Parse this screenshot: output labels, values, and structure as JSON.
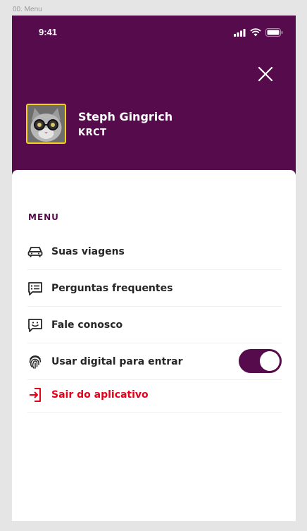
{
  "frame_label": "00. Menu",
  "status_bar": {
    "time": "9:41"
  },
  "profile": {
    "name": "Steph Gingrich",
    "company": "KRCT"
  },
  "menu": {
    "title": "MENU",
    "items": [
      {
        "label": "Suas viagens",
        "icon": "car-icon"
      },
      {
        "label": "Perguntas frequentes",
        "icon": "faq-list-icon"
      },
      {
        "label": "Fale conosco",
        "icon": "chat-smile-icon"
      },
      {
        "label": "Usar digital para entrar",
        "icon": "fingerprint-icon",
        "toggle_on": true
      },
      {
        "label": "Sair do aplicativo",
        "icon": "logout-icon"
      }
    ]
  },
  "colors": {
    "brand": "#560c4c",
    "danger": "#e5001a",
    "avatar_border": "#f2d21b"
  }
}
